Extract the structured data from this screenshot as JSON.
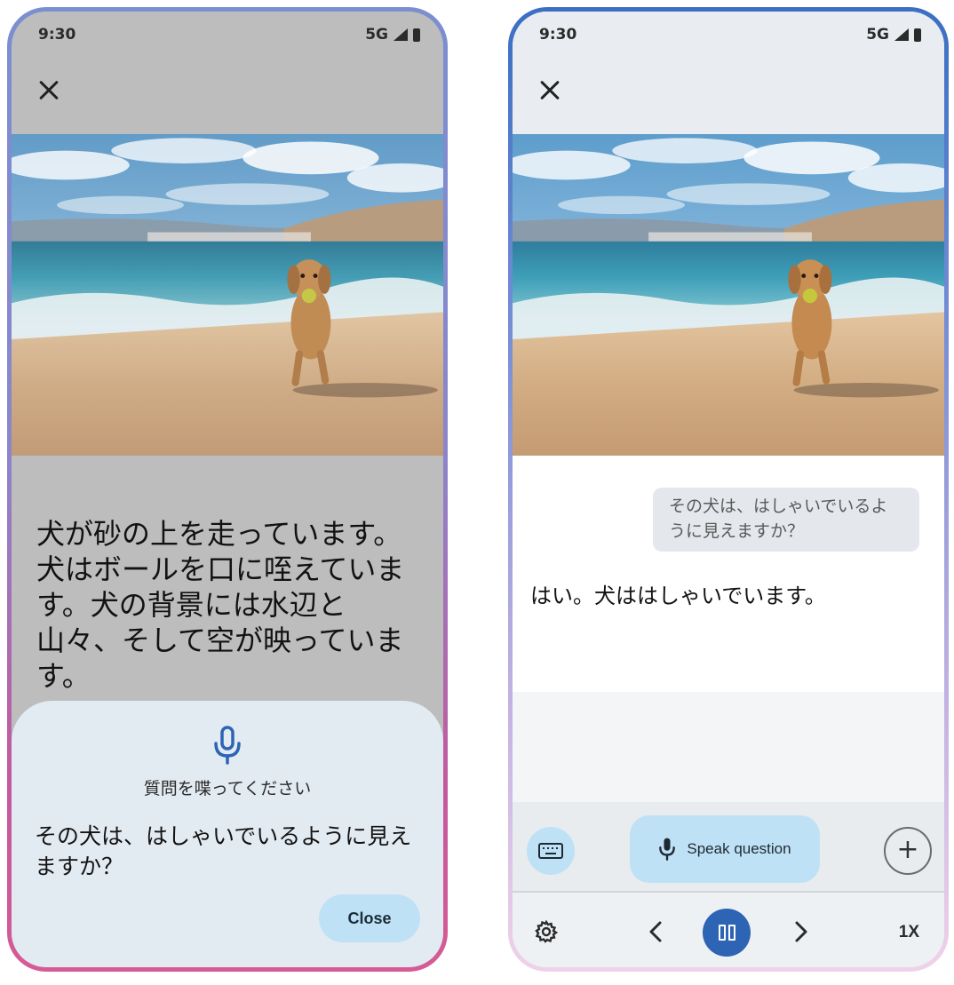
{
  "status": {
    "time": "9:30",
    "network": "5G"
  },
  "left_screen": {
    "description": "犬が砂の上を走っています。犬はボールを口に咥えています。犬の背景には水辺と山々、そして空が映っています。",
    "sheet": {
      "prompt": "質問を喋ってください",
      "question": "その犬は、はしゃいでいるように見えますか？",
      "close_label": "Close"
    }
  },
  "right_screen": {
    "user_question": "その犬は、はしゃいでいるように見えますか？",
    "answer": "はい。犬ははしゃいでいます。",
    "toolbar": {
      "speak_label": "Speak question"
    },
    "playback": {
      "speed": "1X"
    }
  },
  "icons": [
    "close-icon",
    "microphone-icon",
    "keyboard-icon",
    "plus-icon",
    "settings-gear-icon",
    "chevron-left-icon",
    "pause-icon",
    "chevron-right-icon",
    "signal-icon",
    "battery-icon"
  ],
  "colors": {
    "accent_light": "#bfe1f5",
    "accent_dark": "#2e64b4",
    "sheet_bg": "#e3ebf2"
  }
}
